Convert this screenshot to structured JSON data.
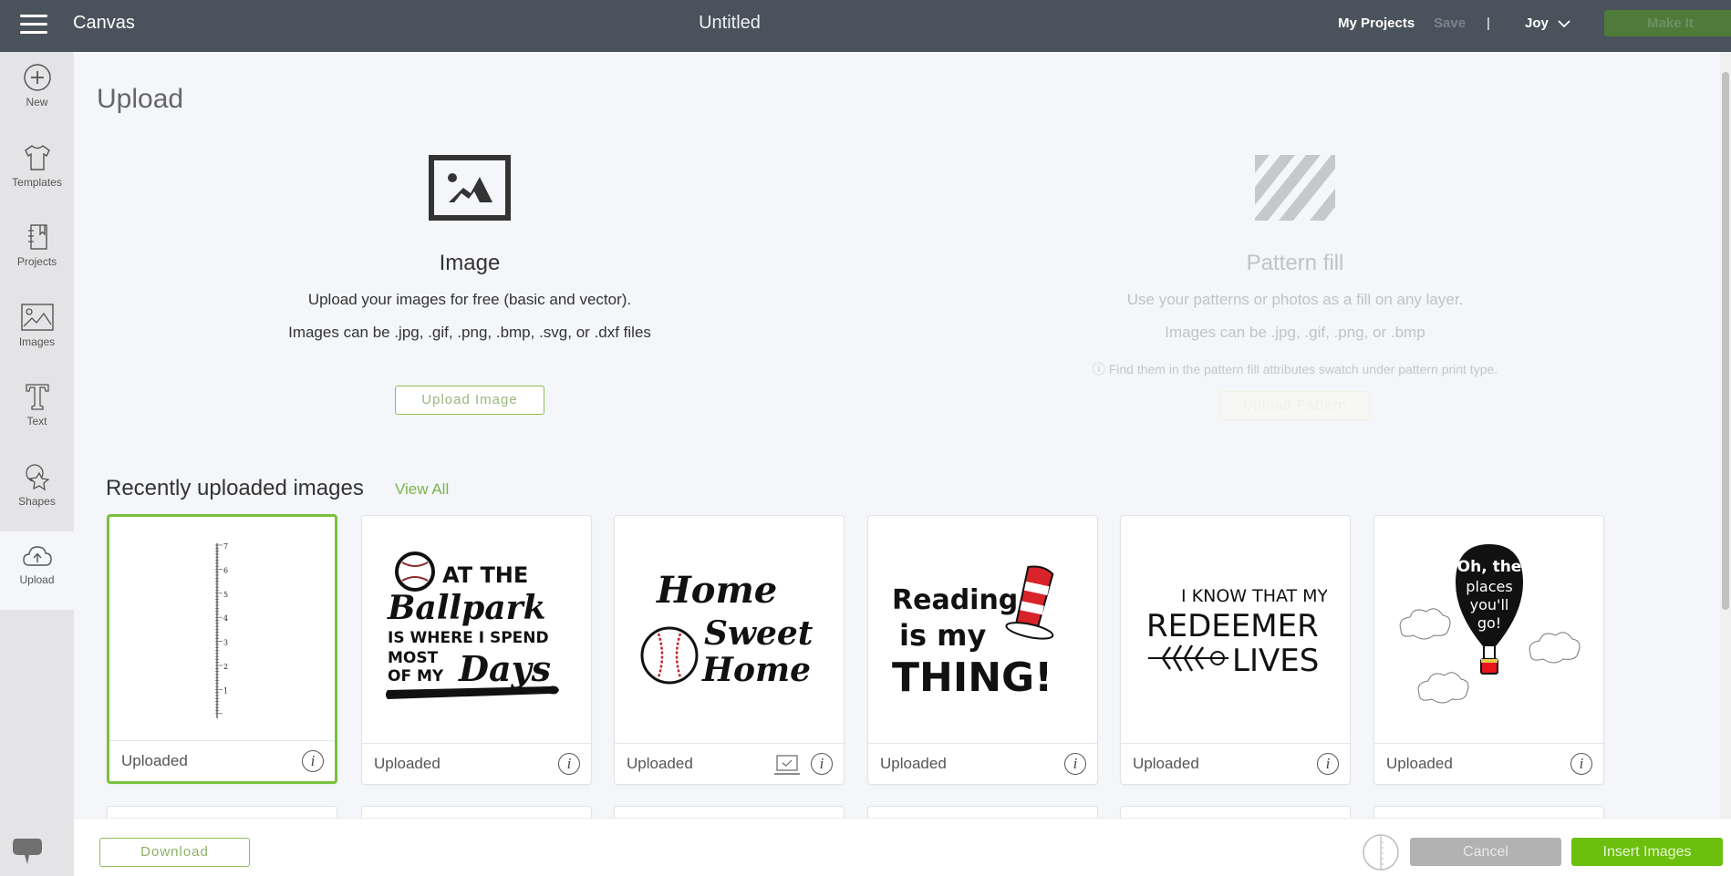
{
  "header": {
    "app_title": "Canvas",
    "doc_title": "Untitled",
    "my_projects": "My Projects",
    "save": "Save",
    "divider": "|",
    "user": "Joy",
    "make_it": "Make It",
    "colors": {
      "bar": "#4a535b",
      "make_it": "#4f7a3a"
    }
  },
  "sidebar": {
    "items": [
      {
        "label": "New",
        "icon": "plus-circle-icon"
      },
      {
        "label": "Templates",
        "icon": "tshirt-icon"
      },
      {
        "label": "Projects",
        "icon": "notebook-icon"
      },
      {
        "label": "Images",
        "icon": "image-icon"
      },
      {
        "label": "Text",
        "icon": "text-t-icon"
      },
      {
        "label": "Shapes",
        "icon": "shapes-icon"
      },
      {
        "label": "Upload",
        "icon": "cloud-upload-icon",
        "active": true
      }
    ],
    "chat_icon": "chat-bubble-icon"
  },
  "main": {
    "title": "Upload",
    "image_upload": {
      "title": "Image",
      "line1": "Upload your images for free (basic and vector).",
      "line2": "Images can be .jpg, .gif, .png, .bmp, .svg, or .dxf files",
      "button": "Upload Image"
    },
    "pattern_upload": {
      "title": "Pattern fill",
      "line1": "Use your patterns or photos as a fill on any layer.",
      "line2": "Images can be .jpg, .gif, .png, or .bmp",
      "note": "ⓘ Find them in the pattern fill attributes swatch under pattern print type.",
      "button": "Upload Pattern"
    },
    "recent": {
      "title": "Recently uploaded images",
      "view_all": "View All",
      "cards": [
        {
          "status": "Uploaded",
          "content": "growth chart ruler 1–7",
          "selected": true
        },
        {
          "status": "Uploaded",
          "content": "At the Ballpark is where I spend most of my days"
        },
        {
          "status": "Uploaded",
          "content": "Home Sweet Home",
          "has_laptop_icon": true
        },
        {
          "status": "Uploaded",
          "content": "Reading is my THING!"
        },
        {
          "status": "Uploaded",
          "content": "I know that my Redeemer lives"
        },
        {
          "status": "Uploaded",
          "content": "Oh, the places you'll go!"
        }
      ]
    }
  },
  "footer": {
    "download": "Download",
    "cancel": "Cancel",
    "insert": "Insert Images",
    "colors": {
      "insert": "#6cbf0c",
      "cancel": "#b2b2b2"
    }
  },
  "art": {
    "ruler_ticks": [
      "7",
      "6",
      "5",
      "4",
      "3",
      "2",
      "1"
    ],
    "ballpark": [
      "AT THE",
      "Ballpark",
      "IS WHERE I SPEND",
      "MOST",
      "OF MY",
      "Days"
    ],
    "home": [
      "Home",
      "Sweet",
      "Home"
    ],
    "reading": [
      "Reading",
      "is my",
      "THING!"
    ],
    "redeemer": [
      "I KNOW THAT MY",
      "REDEEMER",
      "LIVES"
    ],
    "balloon": [
      "Oh, the",
      "places",
      "you'll",
      "go!"
    ]
  }
}
